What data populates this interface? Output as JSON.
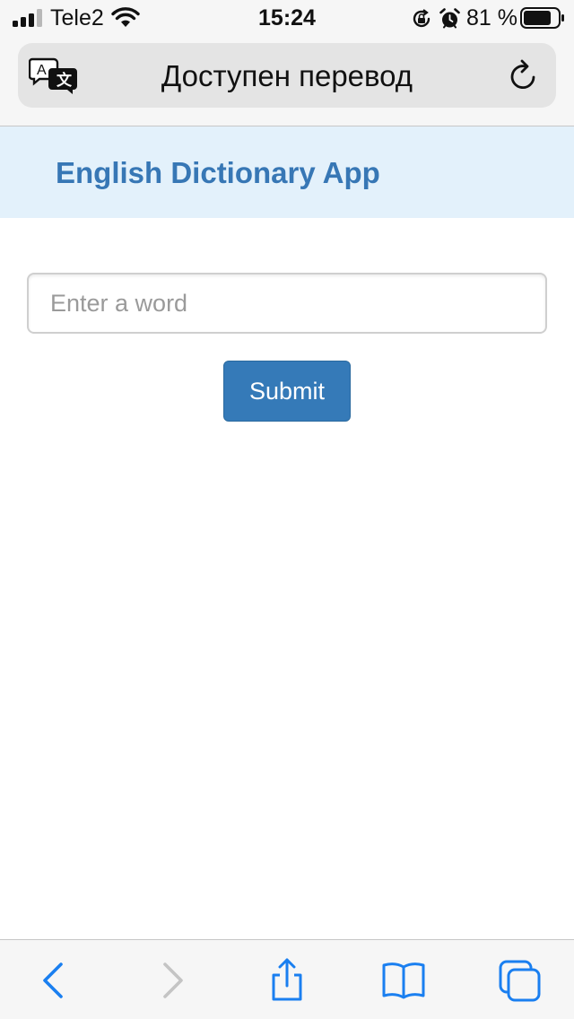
{
  "status_bar": {
    "carrier": "Tele2",
    "time": "15:24",
    "battery_percent": "81 %",
    "battery_level": 0.81,
    "icons": [
      "signal-icon",
      "wifi-icon",
      "rotation-lock-icon",
      "alarm-icon",
      "battery-icon"
    ]
  },
  "browser": {
    "title": "Доступен перевод",
    "icons": [
      "translate-icon",
      "reload-icon"
    ]
  },
  "app": {
    "title": "English Dictionary App",
    "input_placeholder": "Enter a word",
    "input_value": "",
    "submit_label": "Submit"
  },
  "toolbar": {
    "icons": [
      "back-icon",
      "forward-icon",
      "share-icon",
      "bookmarks-icon",
      "tabs-icon"
    ]
  },
  "colors": {
    "accent": "#357ab8",
    "title": "#3777b5",
    "header_bg": "#e3f1fb",
    "ios_blue": "#1a7ff0"
  }
}
